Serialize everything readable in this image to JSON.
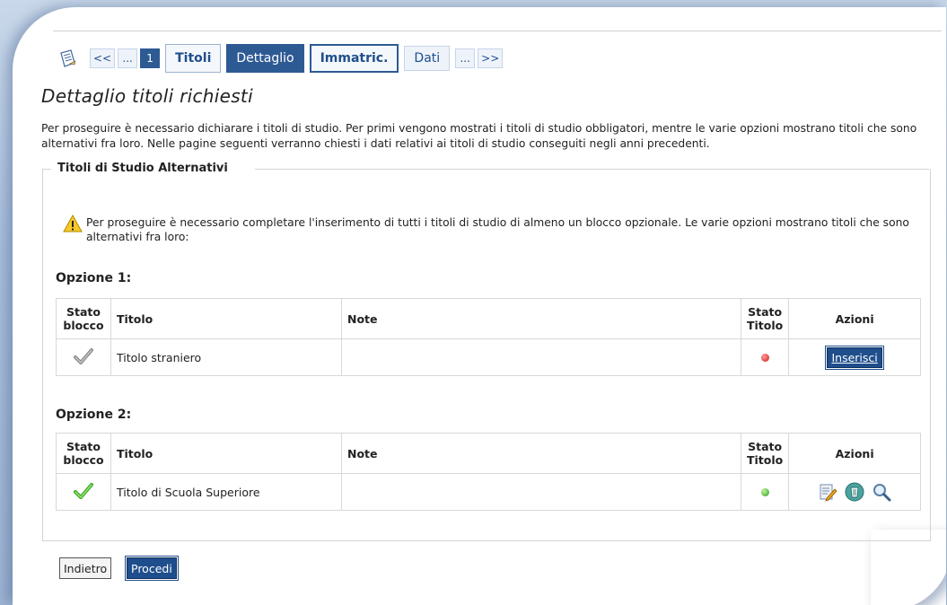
{
  "breadcrumb": {
    "first": "<<",
    "ellipsis_left": "...",
    "step_number": "1",
    "steps": [
      "Titoli",
      "Dettaglio",
      "Immatric.",
      "Dati"
    ],
    "ellipsis_right": "...",
    "last": ">>"
  },
  "page": {
    "title": "Dettaglio titoli richiesti",
    "intro": "Per proseguire è necessario dichiarare i titoli di studio. Per primi vengono mostrati i titoli di studio obbligatori, mentre le varie opzioni mostrano titoli che sono alternativi fra loro. Nelle pagine seguenti verranno chiesti i dati relativi ai titoli di studio conseguiti negli anni precedenti."
  },
  "section": {
    "legend": "Titoli di Studio Alternativi",
    "warning": "Per proseguire è necessario completare l'inserimento di tutti i titoli di studio di almeno un blocco opzionale. Le varie opzioni mostrano titoli che sono alternativi fra loro:"
  },
  "table_headers": {
    "stato_blocco_1": "Stato",
    "stato_blocco_2": "blocco",
    "titolo": "Titolo",
    "note": "Note",
    "stato_titolo_1": "Stato",
    "stato_titolo_2": "Titolo",
    "azioni": "Azioni"
  },
  "options": [
    {
      "label": "Opzione 1:",
      "row": {
        "titolo": "Titolo straniero",
        "note": "",
        "block_status": "grey-check-icon",
        "title_status": "red",
        "action_label": "Inserisci"
      }
    },
    {
      "label": "Opzione 2:",
      "row": {
        "titolo": "Titolo di Scuola Superiore",
        "note": "",
        "block_status": "green-check-icon",
        "title_status": "green",
        "action_icons": [
          "edit-icon",
          "delete-icon",
          "view-icon"
        ]
      }
    }
  ],
  "buttons": {
    "back": "Indietro",
    "next": "Procedi"
  },
  "colors": {
    "primary": "#1f4e8c",
    "status_red": "#d01a1a",
    "status_green": "#2f9a13"
  }
}
